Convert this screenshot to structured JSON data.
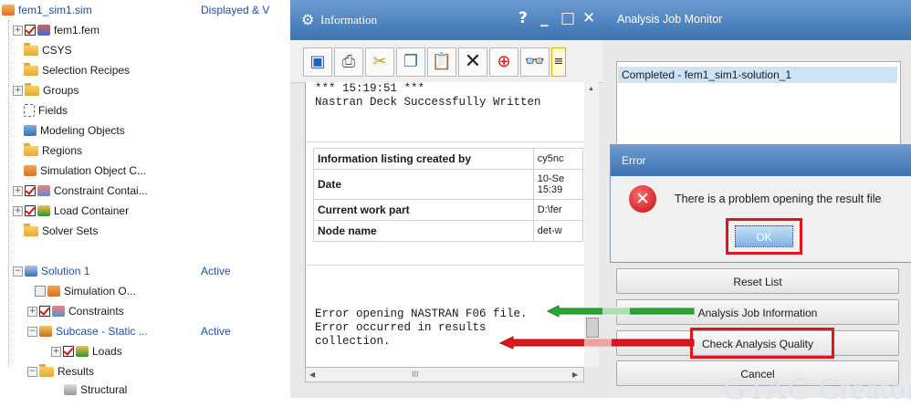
{
  "navigator": {
    "column2_header": "Displayed & V",
    "rows": [
      {
        "label": "fem1_sim1.sim",
        "col2": ""
      },
      {
        "label": "fem1.fem",
        "col2": ""
      },
      {
        "label": "CSYS",
        "col2": ""
      },
      {
        "label": "Selection Recipes",
        "col2": ""
      },
      {
        "label": "Groups",
        "col2": ""
      },
      {
        "label": "Fields",
        "col2": ""
      },
      {
        "label": "Modeling Objects",
        "col2": ""
      },
      {
        "label": "Regions",
        "col2": ""
      },
      {
        "label": "Simulation Object C...",
        "col2": ""
      },
      {
        "label": "Constraint Contai...",
        "col2": ""
      },
      {
        "label": "Load Container",
        "col2": ""
      },
      {
        "label": "Solver Sets",
        "col2": ""
      },
      {
        "label": "Solution 1",
        "col2": "Active"
      },
      {
        "label": "Simulation O...",
        "col2": ""
      },
      {
        "label": "Constraints",
        "col2": ""
      },
      {
        "label": "Subcase - Static ...",
        "col2": "Active"
      },
      {
        "label": "Loads",
        "col2": ""
      },
      {
        "label": "Results",
        "col2": ""
      },
      {
        "label": "Structural",
        "col2": ""
      }
    ]
  },
  "information_window": {
    "title": "Information",
    "controls": [
      "?",
      "_",
      "□",
      "✕"
    ],
    "toolbar_icons": [
      "save-icon",
      "print-icon",
      "cut-icon",
      "copy-icon",
      "paste-icon",
      "delete-icon",
      "find-icon",
      "glasses-icon",
      "notes-icon"
    ],
    "header_text": "*** 15:19:51 ***\nNastran Deck Successfully Written",
    "listing_table": [
      {
        "key": "Information listing created by",
        "value": "cy5nc"
      },
      {
        "key": "Date",
        "value": "10-Se\n15:39"
      },
      {
        "key": "Current work part",
        "value": "D:\\fer"
      },
      {
        "key": "Node name",
        "value": "det-w"
      }
    ],
    "error_text": "Error opening NASTRAN F06 file.\nError occurred in results\ncollection.",
    "hscroll_thumb": "III"
  },
  "job_monitor": {
    "title": "Analysis Job Monitor",
    "list_items": [
      "Completed - fem1_sim1-solution_1"
    ],
    "buttons": {
      "reset_list": "Reset List",
      "job_information": "Analysis Job Information",
      "check_quality": "Check Analysis Quality",
      "cancel": "Cancel"
    }
  },
  "error_dialog": {
    "title": "Error",
    "message": "There is a problem opening the result file",
    "ok_label": "OK",
    "icon": "error-x-icon"
  },
  "annotation_colors": {
    "red": "#e0161e",
    "green": "#26a832"
  },
  "watermark": "GTAC Creator"
}
